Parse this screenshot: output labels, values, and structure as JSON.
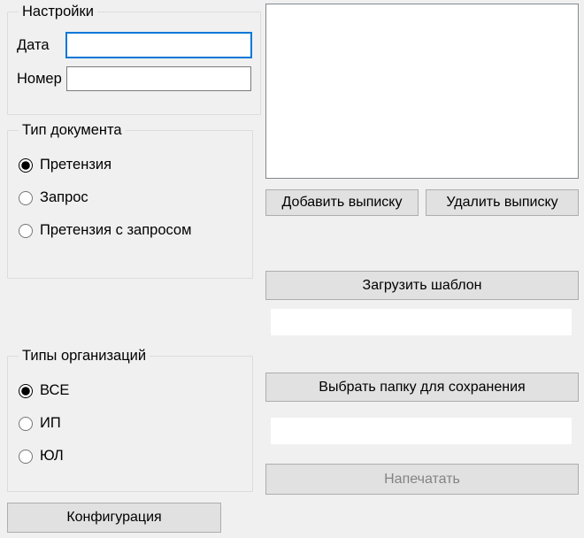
{
  "settings": {
    "legend": "Настройки",
    "date_label": "Дата",
    "date_value": "",
    "number_label": "Номер",
    "number_value": ""
  },
  "doctype": {
    "legend": "Тип документа",
    "options": [
      {
        "label": "Претензия",
        "selected": true
      },
      {
        "label": "Запрос",
        "selected": false
      },
      {
        "label": "Претензия с запросом",
        "selected": false
      }
    ]
  },
  "orgtype": {
    "legend": "Типы организаций",
    "options": [
      {
        "label": "ВСЕ",
        "selected": true
      },
      {
        "label": "ИП",
        "selected": false
      },
      {
        "label": "ЮЛ",
        "selected": false
      }
    ]
  },
  "buttons": {
    "config": "Конфигурация",
    "add_extract": "Добавить выписку",
    "remove_extract": "Удалить выписку",
    "load_template": "Загрузить шаблон",
    "choose_folder": "Выбрать папку для сохранения",
    "print": "Напечатать"
  },
  "paths": {
    "template": "",
    "folder": ""
  },
  "listbox_items": []
}
